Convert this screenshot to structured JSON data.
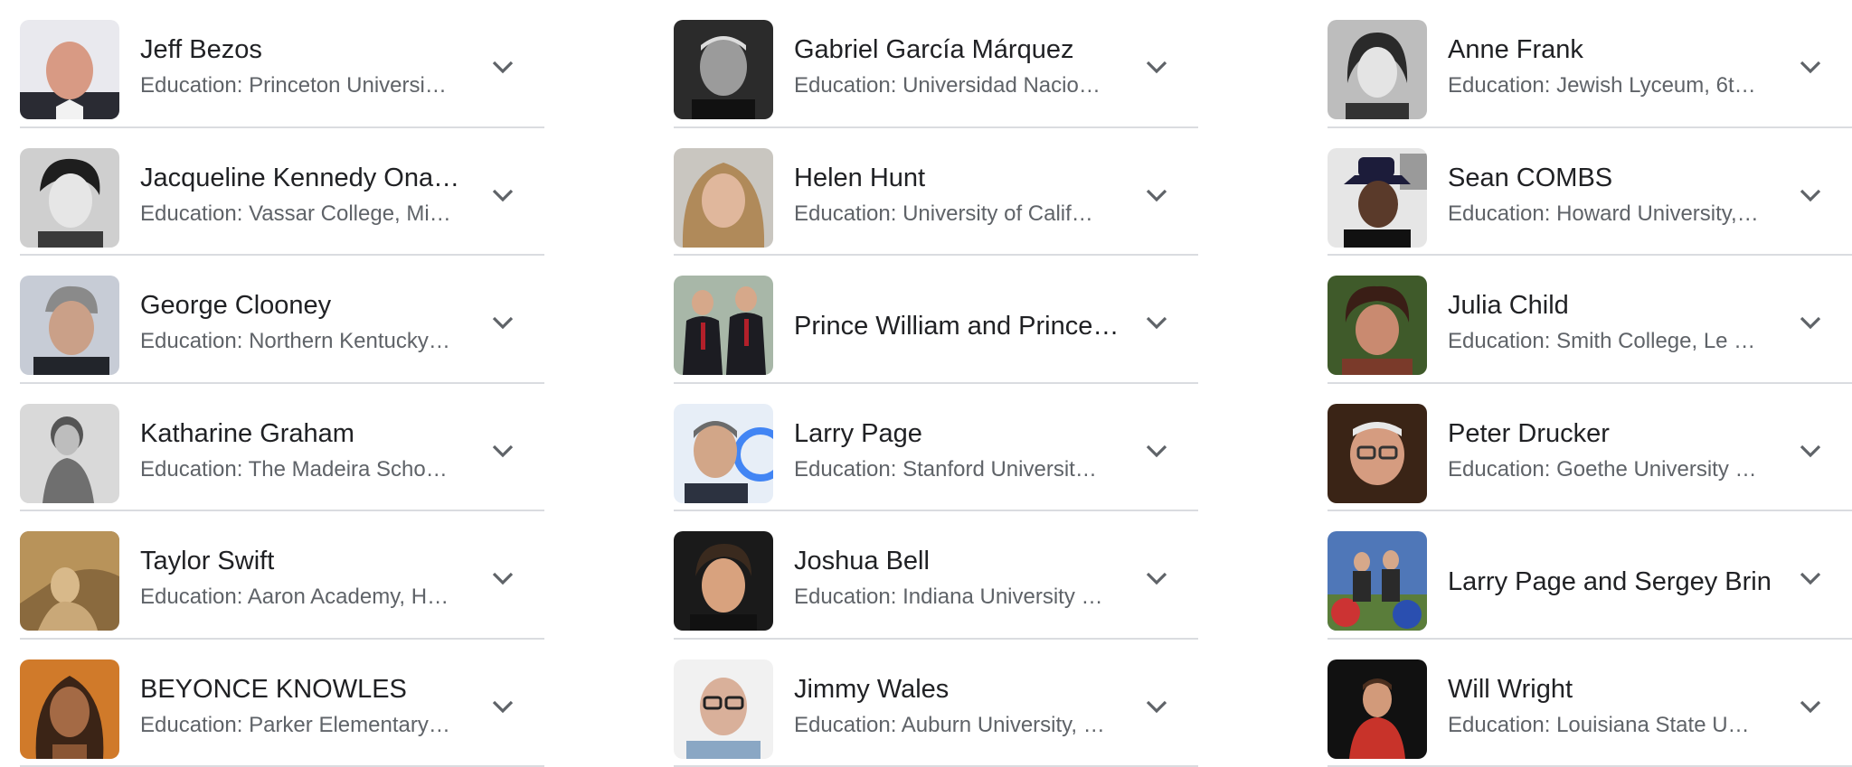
{
  "columns": [
    {
      "rows": [
        {
          "name": "Jeff Bezos",
          "subtitle": "Education: Princeton Universi…",
          "icon": "portrait"
        },
        {
          "name": "Jacqueline Kennedy Ona…",
          "subtitle": "Education: Vassar College, Mi…",
          "icon": "portrait"
        },
        {
          "name": "George Clooney",
          "subtitle": "Education: Northern Kentucky…",
          "icon": "portrait"
        },
        {
          "name": "Katharine Graham",
          "subtitle": "Education: The Madeira Scho…",
          "icon": "portrait"
        },
        {
          "name": "Taylor Swift",
          "subtitle": "Education: Aaron Academy, H…",
          "icon": "portrait"
        },
        {
          "name": "BEYONCE KNOWLES",
          "subtitle": "Education: Parker Elementary…",
          "icon": "portrait"
        }
      ]
    },
    {
      "rows": [
        {
          "name": "Gabriel García Márquez",
          "subtitle": "Education: Universidad Nacio…",
          "icon": "portrait"
        },
        {
          "name": "Helen Hunt",
          "subtitle": "Education: University of Calif…",
          "icon": "portrait"
        },
        {
          "name": "Prince William and Prince…",
          "subtitle": "",
          "icon": "portrait"
        },
        {
          "name": "Larry Page",
          "subtitle": "Education: Stanford Universit…",
          "icon": "portrait"
        },
        {
          "name": "Joshua Bell",
          "subtitle": "Education: Indiana University …",
          "icon": "portrait"
        },
        {
          "name": "Jimmy Wales",
          "subtitle": "Education: Auburn University, …",
          "icon": "portrait"
        }
      ]
    },
    {
      "rows": [
        {
          "name": "Anne Frank",
          "subtitle": "Education: Jewish Lyceum, 6t…",
          "icon": "portrait"
        },
        {
          "name": "Sean COMBS",
          "subtitle": "Education: Howard University,…",
          "icon": "portrait"
        },
        {
          "name": "Julia Child",
          "subtitle": "Education: Smith College, Le …",
          "icon": "portrait"
        },
        {
          "name": "Peter Drucker",
          "subtitle": "Education: Goethe University …",
          "icon": "portrait"
        },
        {
          "name": "Larry Page and Sergey Brin",
          "subtitle": "",
          "icon": "portrait"
        },
        {
          "name": "Will Wright",
          "subtitle": "Education: Louisiana State U…",
          "icon": "portrait"
        }
      ]
    }
  ],
  "colors": {
    "name_text": "#202124",
    "subtitle_text": "#5f6368",
    "divider": "#dadce0",
    "chevron": "#5f6368"
  },
  "expand_icon": "chevron-down-icon"
}
